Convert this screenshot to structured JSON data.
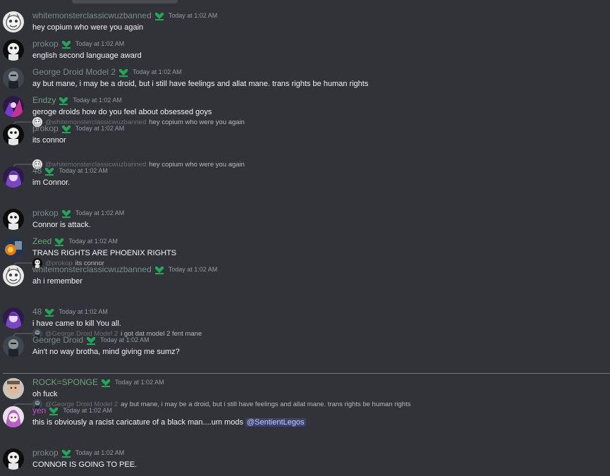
{
  "colors": {
    "background": "#313338",
    "new_messages_line": "#f23f43",
    "badge_green": "#23a55a",
    "mention_bg": "#3c4270"
  },
  "messages": [
    {
      "author": "whitemonsterclassicwuzbanned",
      "author_color": "#7c8d8a",
      "time": "Today at 1:02 AM",
      "text": "hey  copium who were you again",
      "avatar": "monster"
    },
    {
      "author": "prokop",
      "author_color": "#7c8d8a",
      "time": "Today at 1:02 AM",
      "text": "english second language award",
      "avatar": "prokop"
    },
    {
      "author": "George Droid Model 2",
      "author_color": "#7c8d8a",
      "time": "Today at 1:02 AM",
      "text": "ay but mane, i may be a droid, but i still have feelings and allat mane. trans rights be human rights",
      "avatar": "droid"
    },
    {
      "author": "Endzy",
      "author_color": "#6aa37b",
      "time": "Today at 1:02 AM",
      "text": "geroge droids how do you feel about obsessed goys",
      "avatar": "endzy"
    },
    {
      "reply": {
        "name": "@whitemonsterclassicwuzbanned",
        "text": "hey  copium who were you again"
      },
      "author": "prokop",
      "author_color": "#7c8d8a",
      "time": "Today at 1:02 AM",
      "text": "its connor",
      "avatar": "prokop"
    },
    {
      "reply": {
        "name": "@whitemonsterclassicwuzbanned",
        "text": "hey  copium who were you again"
      },
      "author": "48",
      "author_color": "#7c8d8a",
      "time": "Today at 1:02 AM",
      "text": "im Connor.",
      "avatar": "48"
    },
    {
      "author": "prokop",
      "author_color": "#7c8d8a",
      "time": "Today at 1:02 AM",
      "text": "Connor is attack.",
      "avatar": "prokop"
    },
    {
      "author": "Zeed",
      "author_color": "#6aa37b",
      "time": "Today at 1:02 AM",
      "text": "TRANS RIGHTS ARE PHOENIX RIGHTS",
      "avatar": "zeed"
    },
    {
      "reply": {
        "name": "@prokop",
        "text": "its connor"
      },
      "author": "whitemonsterclassicwuzbanned",
      "author_color": "#7c8d8a",
      "time": "Today at 1:02 AM",
      "text": "ah i remember",
      "avatar": "monster"
    },
    {
      "author": "48",
      "author_color": "#7c8d8a",
      "time": "Today at 1:02 AM",
      "text": "i have came to kill You all.",
      "avatar": "48"
    },
    {
      "reply": {
        "name": "@George Droid Model 2",
        "text": "i got dat model 2 fent mane"
      },
      "author": "George Droid",
      "author_color": "#7c8d8a",
      "time": "Today at 1:02 AM",
      "text": "Ain't no way brotha, mind giving me sumz?",
      "avatar": "droid"
    },
    {
      "author": "ROCK=SPONGE",
      "author_color": "#6aa37b",
      "time": "Today at 1:02 AM",
      "text": "oh fuck",
      "avatar": "rock"
    },
    {
      "reply": {
        "name": "@George Droid Model 2",
        "text": "ay but mane, i may be a droid, but i still have feelings and allat mane. trans rights be human rights"
      },
      "author": "yen",
      "author_color": "#c850d8",
      "time": "Today at 1:02 AM",
      "text": "this is obviously a racist caricature of a black man....um mods ",
      "mention": "@SentientLegos",
      "avatar": "yen"
    },
    {
      "author": "prokop",
      "author_color": "#7c8d8a",
      "time": "Today at 1:02 AM",
      "text": "CONNOR IS GOING TO PEE.",
      "avatar": "prokop"
    }
  ]
}
